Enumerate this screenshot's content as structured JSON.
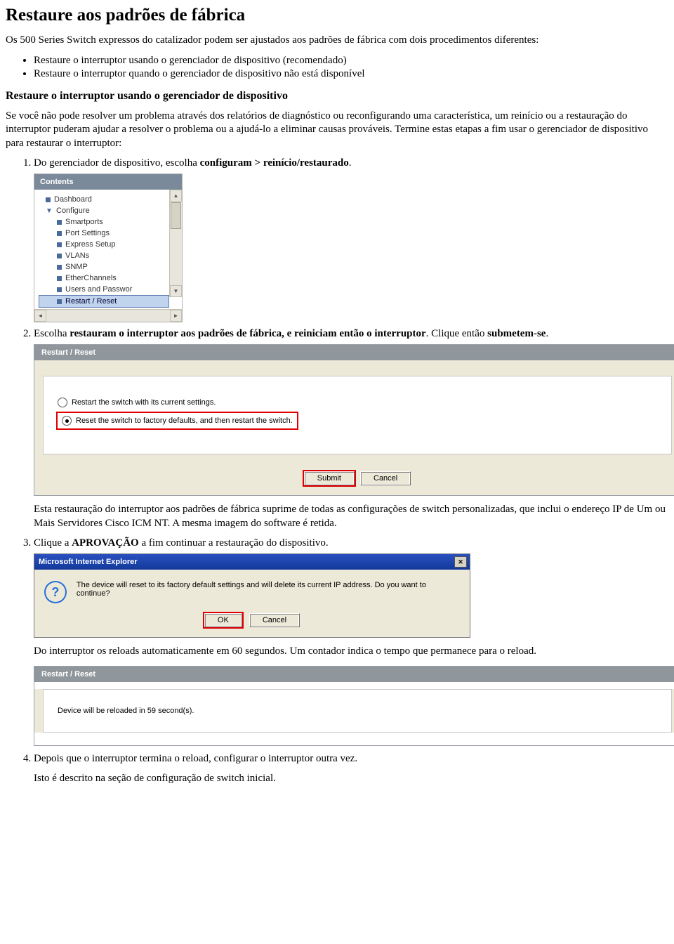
{
  "title": "Restaure aos padrões de fábrica",
  "intro": "Os 500 Series Switch expressos do catalizador podem ser ajustados aos padrões de fábrica com dois procedimentos diferentes:",
  "bullets": [
    "Restaure o interruptor usando o gerenciador de dispositivo (recomendado)",
    "Restaure o interruptor quando o gerenciador de dispositivo não está disponível"
  ],
  "section_title": "Restaure o interruptor usando o gerenciador de dispositivo",
  "para1": "Se você não pode resolver um problema através dos relatórios de diagnóstico ou reconfigurando uma característica, um reinício ou a restauração do interruptor puderam ajudar a resolver o problema ou a ajudá-lo a eliminar causas prováveis. Termine estas etapas a fim usar o gerenciador de dispositivo para restaurar o interruptor:",
  "steps": {
    "s1_pre": "Do gerenciador de dispositivo, escolha ",
    "s1_bold": "configuram > reinício/restaurado",
    "s1_post": ".",
    "s2_pre": "Escolha ",
    "s2_bold": "restauram o interruptor aos padrões de fábrica, e reiniciam então o interruptor",
    "s2_mid": ". Clique então ",
    "s2_bold2": "submetem-se",
    "s2_post": ".",
    "s2_note": "Esta restauração do interruptor aos padrões de fábrica suprime de todas as configurações de switch personalizadas, que inclui o endereço IP de Um ou Mais Servidores Cisco ICM NT. A mesma imagem do software é retida.",
    "s3_pre": "Clique a ",
    "s3_bold": "APROVAÇÃO",
    "s3_post": " a fim continuar a restauração do dispositivo.",
    "s3_note": "Do interruptor os reloads automaticamente em 60 segundos. Um contador indica o tempo que permanece para o reload.",
    "s4": "Depois que o interruptor termina o reload, configurar o interruptor outra vez.",
    "s4_note": "Isto é descrito na seção de configuração de switch inicial."
  },
  "contents_panel": {
    "header": "Contents",
    "items": [
      {
        "label": "Dashboard",
        "type": "leaf"
      },
      {
        "label": "Configure",
        "type": "parent"
      },
      {
        "label": "Smartports",
        "type": "child"
      },
      {
        "label": "Port Settings",
        "type": "child"
      },
      {
        "label": "Express Setup",
        "type": "child"
      },
      {
        "label": "VLANs",
        "type": "child"
      },
      {
        "label": "SNMP",
        "type": "child"
      },
      {
        "label": "EtherChannels",
        "type": "child"
      },
      {
        "label": "Users and Passwor",
        "type": "child"
      },
      {
        "label": "Restart / Reset",
        "type": "child-selected"
      }
    ]
  },
  "restart_panel": {
    "title": "Restart / Reset",
    "opt1": "Restart the switch with its current settings.",
    "opt2": "Reset the switch to factory defaults, and then restart the switch.",
    "submit": "Submit",
    "cancel": "Cancel"
  },
  "ie_dialog": {
    "title": "Microsoft Internet Explorer",
    "message": "The device will reset to its factory default settings and will delete its current IP address. Do you want to continue?",
    "ok": "OK",
    "cancel": "Cancel"
  },
  "reload_panel": {
    "title": "Restart / Reset",
    "message": "Device will be reloaded in 59 second(s)."
  }
}
